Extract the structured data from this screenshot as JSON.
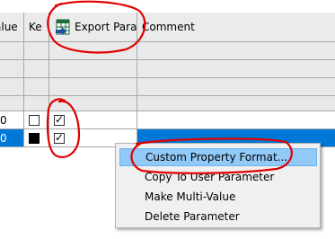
{
  "grid": {
    "columns": [
      {
        "label": "alue"
      },
      {
        "label": "Ke"
      },
      {
        "label": "Export Parar"
      },
      {
        "label": "Comment"
      }
    ],
    "rows": [
      {
        "value": "0",
        "key_checked": false,
        "export_checked": true,
        "selected": false
      },
      {
        "value": "0",
        "key_checked": true,
        "export_checked": true,
        "selected": true
      }
    ]
  },
  "context_menu": {
    "items": [
      {
        "label": "Custom Property Format...",
        "highlighted": true
      },
      {
        "label": "Copy To User Parameter",
        "highlighted": false
      },
      {
        "label": "Make Multi-Value",
        "highlighted": false
      },
      {
        "label": "Delete Parameter",
        "highlighted": false
      }
    ]
  },
  "colors": {
    "selection": "#0078d7",
    "menu_highlight": "#91c9f7",
    "annotation": "#e00000",
    "header_bg": "#ebebeb"
  },
  "icons": {
    "export_column": "excel-export-icon",
    "check": "checkmark-icon"
  }
}
